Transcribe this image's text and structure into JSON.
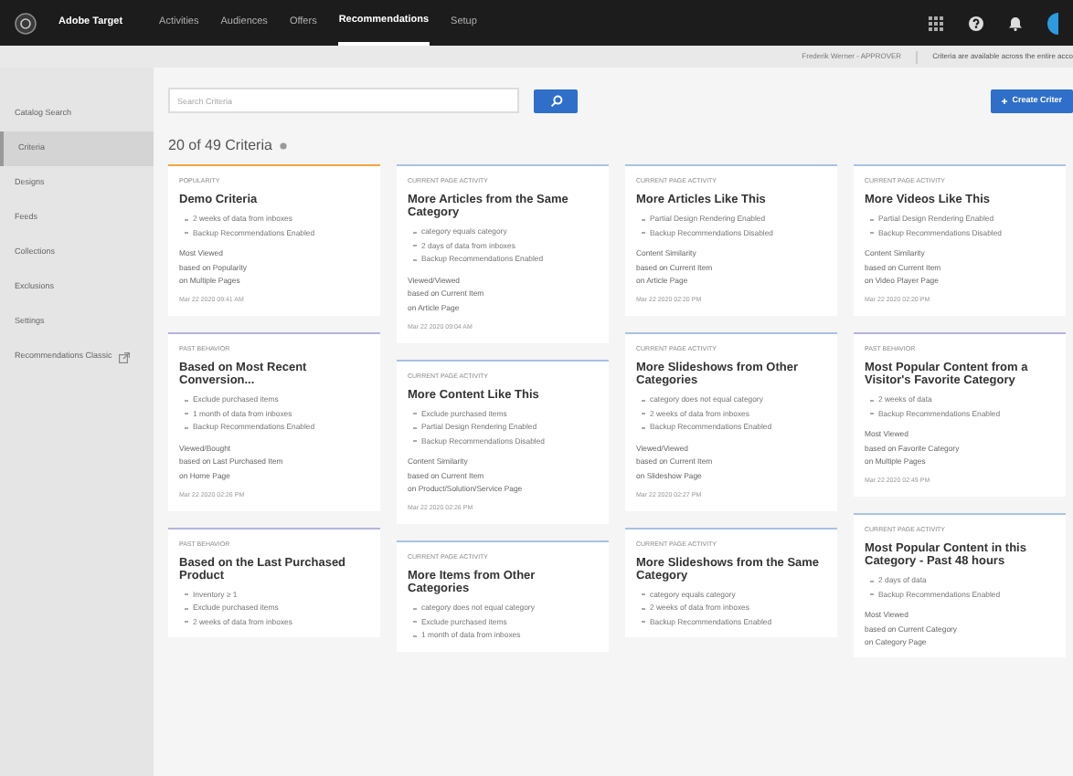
{
  "app": {
    "name": "Adobe Target"
  },
  "nav": [
    {
      "label": "Activities",
      "selected": false
    },
    {
      "label": "Audiences",
      "selected": false
    },
    {
      "label": "Offers",
      "selected": false
    },
    {
      "label": "Recommendations",
      "selected": true
    },
    {
      "label": "Setup",
      "selected": false
    }
  ],
  "sub_bar": {
    "user": "Frederik Werner - APPROVER",
    "notice": "Criteria are available across the entire acco"
  },
  "sidebar": {
    "items": [
      {
        "label": "Catalog Search",
        "selected": false,
        "external": false
      },
      {
        "label": "Criteria",
        "selected": true,
        "external": false
      },
      {
        "label": "Designs",
        "selected": false,
        "external": false
      },
      {
        "label": "Feeds",
        "selected": false,
        "external": false
      },
      {
        "label": "Collections",
        "selected": false,
        "external": false
      },
      {
        "label": "Exclusions",
        "selected": false,
        "external": false
      },
      {
        "label": "Settings",
        "selected": false,
        "external": false
      },
      {
        "label": "Recommendations Classic",
        "selected": false,
        "external": true
      }
    ]
  },
  "search": {
    "placeholder": "Search Criteria"
  },
  "create_button": "Create Criter",
  "heading": "20 of 49 Criteria",
  "columns": [
    {
      "cards": [
        {
          "category": "POPULARITY",
          "color": "#f2a640",
          "title": "Demo Criteria",
          "bullets": [
            "2 weeks of data from inboxes",
            "Backup Recommendations Enabled"
          ],
          "details": [
            "Most Viewed",
            "based on Popularity",
            "on Multiple Pages"
          ],
          "date": "Mar 22 2020 09:41 AM"
        },
        {
          "category": "PAST BEHAVIOR",
          "color": "#b4b4dc",
          "title": "Based on Most Recent Conversion...",
          "bullets": [
            "Exclude purchased items",
            "1 month of data from inboxes",
            "Backup Recommendations Enabled"
          ],
          "details": [
            "Viewed/Bought",
            "based on Last Purchased Item",
            "on Home Page"
          ],
          "date": "Mar 22 2020 02:26 PM"
        },
        {
          "category": "PAST BEHAVIOR",
          "color": "#b4b4dc",
          "title": "Based on the Last Purchased Product",
          "bullets": [
            "Inventory ≥ 1",
            "Exclude purchased items",
            "2 weeks of data from inboxes"
          ]
        }
      ]
    },
    {
      "cards": [
        {
          "category": "CURRENT PAGE ACTIVITY",
          "color": "#a9c2e4",
          "title": "More Articles from the Same Category",
          "bullets": [
            "category equals category",
            "2 days of data from inboxes",
            "Backup Recommendations Enabled"
          ],
          "details": [
            "Viewed/Viewed",
            "based on Current Item",
            "on Article Page"
          ],
          "date": "Mar 22 2020 09:04 AM"
        },
        {
          "category": "CURRENT PAGE ACTIVITY",
          "color": "#a9c2e4",
          "title": "More Content Like This",
          "bullets": [
            "Exclude purchased items",
            "Partial Design Rendering Enabled",
            "Backup Recommendations Disabled"
          ],
          "details": [
            "Content Similarity",
            "based on Current Item",
            "on Product/Solution/Service Page"
          ],
          "date": "Mar 22 2020 02:26 PM"
        },
        {
          "category": "CURRENT PAGE ACTIVITY",
          "color": "#a9c2e4",
          "title": "More Items from Other Categories",
          "bullets": [
            "category does not equal category",
            "Exclude purchased items",
            "1 month of data from inboxes"
          ]
        }
      ]
    },
    {
      "cards": [
        {
          "category": "CURRENT PAGE ACTIVITY",
          "color": "#a9c2e4",
          "title": "More Articles Like This",
          "bullets": [
            "Partial Design Rendering Enabled",
            "Backup Recommendations Disabled"
          ],
          "details": [
            "Content Similarity",
            "based on Current Item",
            "on Article Page"
          ],
          "date": "Mar 22 2020 02:20 PM"
        },
        {
          "category": "CURRENT PAGE ACTIVITY",
          "color": "#a9c2e4",
          "title": "More Slideshows from Other Categories",
          "bullets": [
            "category does not equal category",
            "2 weeks of data from inboxes",
            "Backup Recommendations Enabled"
          ],
          "details": [
            "Viewed/Viewed",
            "based on Current Item",
            "on Slideshow Page"
          ],
          "date": "Mar 22 2020 02:27 PM"
        },
        {
          "category": "CURRENT PAGE ACTIVITY",
          "color": "#a9c2e4",
          "title": "More Slideshows from the Same Category",
          "bullets": [
            "category equals category",
            "2 weeks of data from inboxes",
            "Backup Recommendations Enabled"
          ]
        }
      ]
    },
    {
      "cards": [
        {
          "category": "CURRENT PAGE ACTIVITY",
          "color": "#a9c2e4",
          "title": "More Videos Like This",
          "bullets": [
            "Partial Design Rendering Enabled",
            "Backup Recommendations Disabled"
          ],
          "details": [
            "Content Similarity",
            "based on Current Item",
            "on Video Player Page"
          ],
          "date": "Mar 22 2020 02:20 PM"
        },
        {
          "category": "PAST BEHAVIOR",
          "color": "#b4b4dc",
          "title": "Most Popular Content from a Visitor's Favorite Category",
          "bullets": [
            "2 weeks of data",
            "Backup Recommendations Enabled"
          ],
          "details": [
            "Most Viewed",
            "based on Favorite Category",
            "on Multiple Pages"
          ],
          "date": "Mar 22 2020 02:49 PM"
        },
        {
          "category": "CURRENT PAGE ACTIVITY",
          "color": "#a9c2e4",
          "title": "Most Popular Content in this Category - Past 48 hours",
          "bullets": [
            "2 days of data",
            "Backup Recommendations Enabled"
          ],
          "details": [
            "Most Viewed",
            "based on Current Category",
            "on Category Page"
          ]
        }
      ]
    }
  ]
}
